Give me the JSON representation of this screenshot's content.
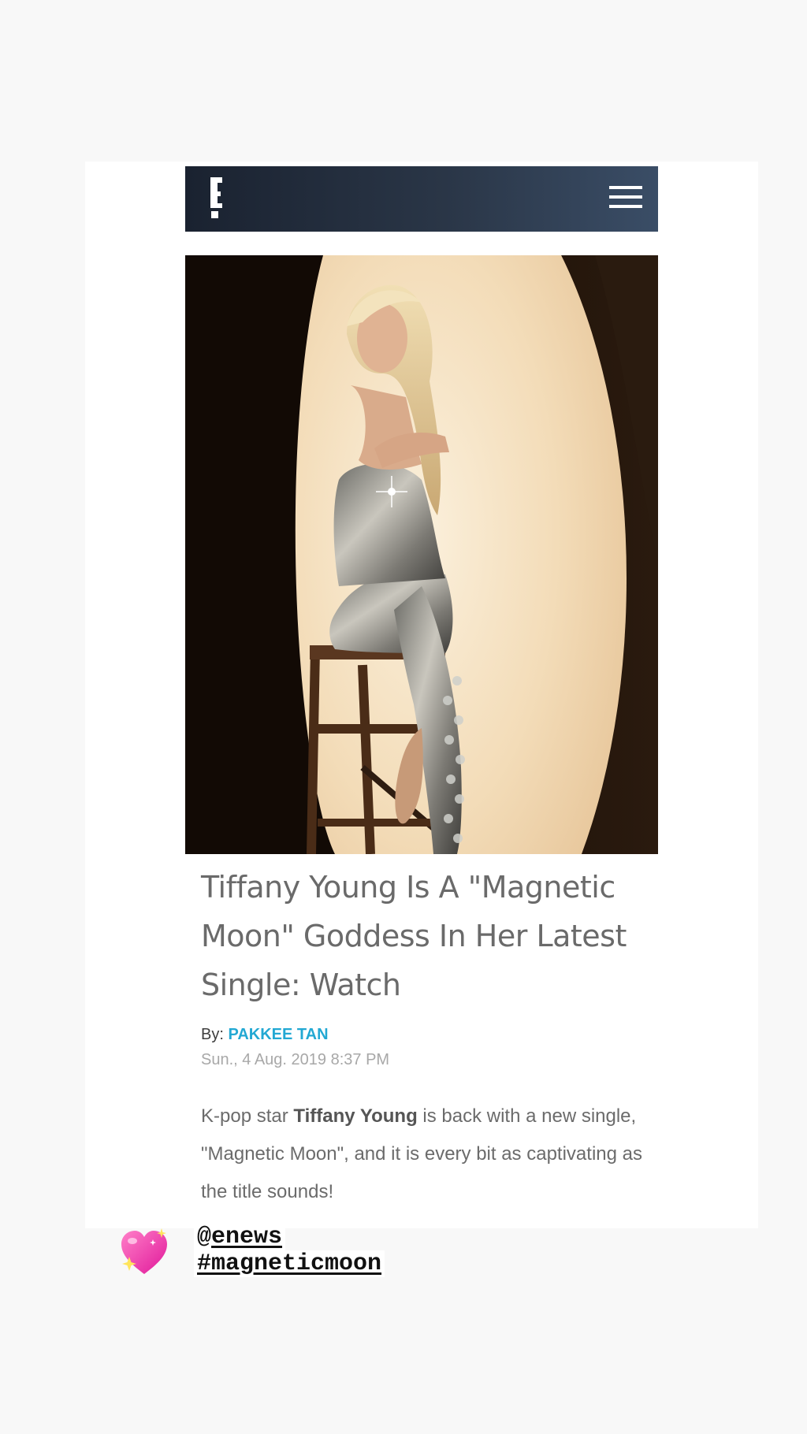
{
  "site": {
    "logo_letter": "E",
    "menu_icon": "hamburger-menu-icon",
    "header_gradient": [
      "#1a2230",
      "#3a4d66"
    ]
  },
  "article": {
    "hero_image": "photo of a blonde woman in a silver sequined outfit seated on a wooden stool under a spotlight",
    "title": "Tiffany Young Is A \"Magnetic Moon\" Goddess In Her Latest Single: Watch",
    "byline_prefix": "By:",
    "author": "PAKKEE TAN",
    "author_color": "#22a8d3",
    "date": "Sun., 4 Aug. 2019 8:37 PM",
    "body_intro": "K-pop star ",
    "body_bold": "Tiffany Young",
    "body_rest": " is back with a new single, \"Magnetic Moon\", and it is every bit as captivating as the title sounds!"
  },
  "story_overlay": {
    "sticker_icon": "sparkling-heart-icon",
    "mention_at": "@",
    "mention_name": "enews",
    "hashtag": "#magneticmoon"
  }
}
